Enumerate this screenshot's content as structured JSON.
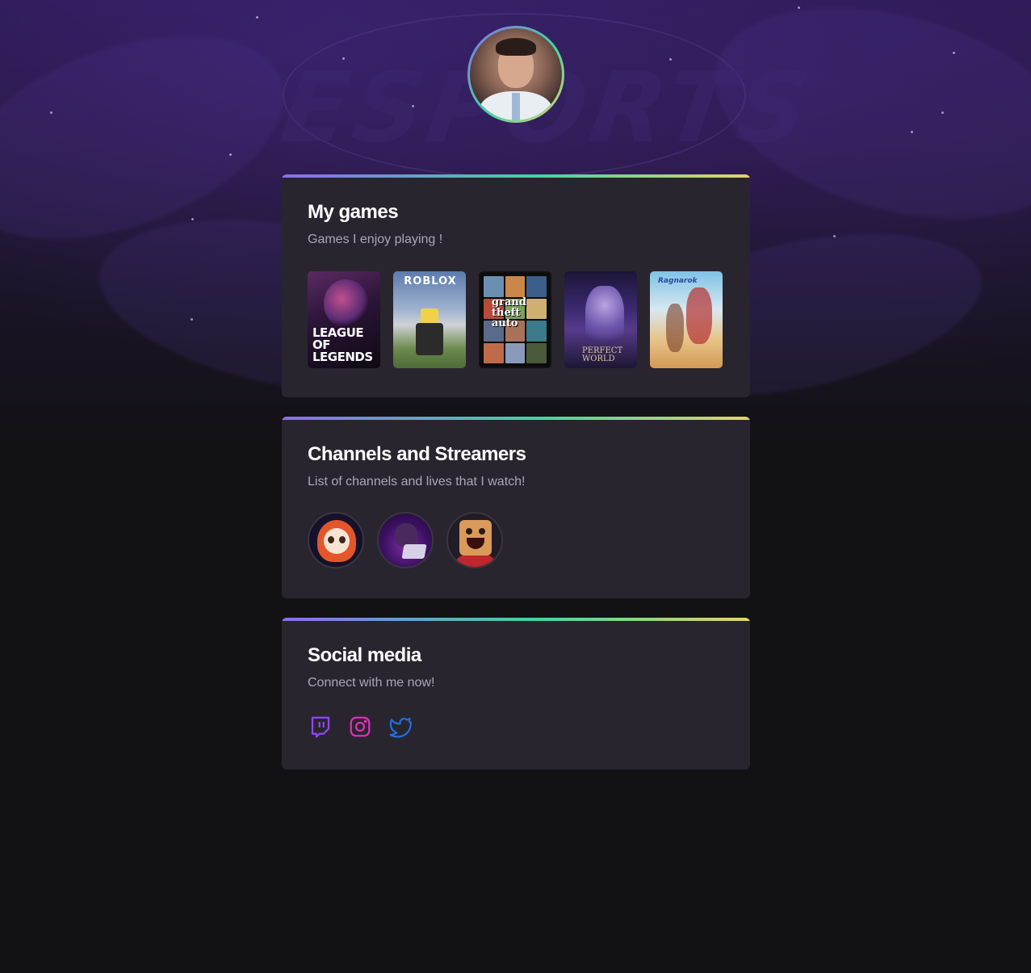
{
  "profile": {
    "avatar_icon": "profile-avatar"
  },
  "watermark": "ESPORTS",
  "games_section": {
    "title": "My games",
    "subtitle": "Games I enjoy playing !",
    "games": [
      {
        "name": "League of Legends",
        "cover_text": "LEAGUE OF LEGENDS"
      },
      {
        "name": "Roblox",
        "cover_text": "ROBLOX"
      },
      {
        "name": "Grand Theft Auto V",
        "cover_text": "grand theft auto"
      },
      {
        "name": "Perfect World",
        "cover_text": "PERFECT WORLD"
      },
      {
        "name": "Ragnarok",
        "cover_text": "Ragnarok"
      }
    ]
  },
  "channels_section": {
    "title": "Channels and Streamers",
    "subtitle": "List of channels and lives that I watch!",
    "channels": [
      {
        "icon": "redhead-streamer-avatar"
      },
      {
        "icon": "laptop-streamer-avatar"
      },
      {
        "icon": "box-character-avatar"
      }
    ]
  },
  "social_section": {
    "title": "Social media",
    "subtitle": "Connect with me now!",
    "links": [
      {
        "icon": "twitch-icon",
        "color": "#9146ff"
      },
      {
        "icon": "instagram-icon",
        "color": "#e02fbd"
      },
      {
        "icon": "twitter-icon",
        "color": "#1f6fe0"
      }
    ]
  },
  "colors": {
    "background": "#121214",
    "card": "#29252f",
    "gradient_start": "#8b6cf0",
    "gradient_mid": "#43d5a0",
    "gradient_end": "#e4d46a",
    "title": "#ffffff",
    "subtitle": "#a8a8b3"
  }
}
